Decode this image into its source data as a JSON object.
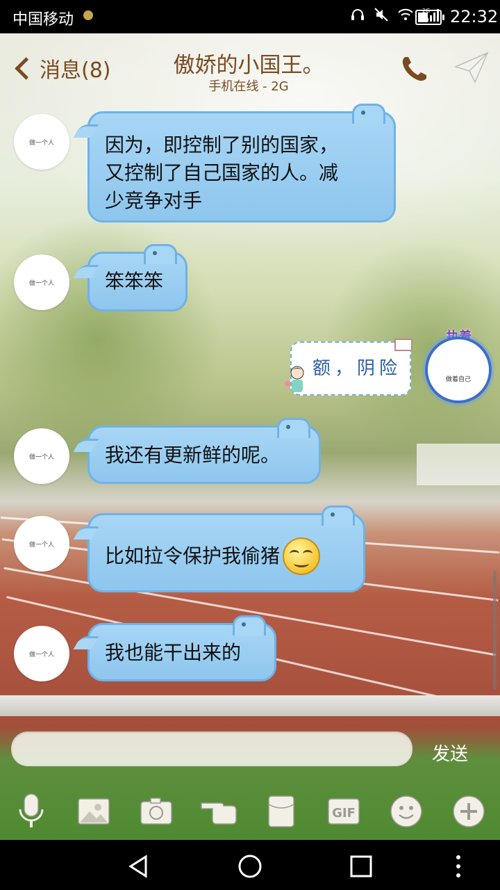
{
  "status_bar": {
    "carrier": "中国移动",
    "network": "2G",
    "time": "22:32",
    "battery_level": 0.45
  },
  "header": {
    "back_label": "消息(8)",
    "title": "傲娇的小国王。",
    "subtitle": "手机在线 - 2G"
  },
  "contact": {
    "avatar_text": "做一个人"
  },
  "me": {
    "avatar_text": "做着自己",
    "badge_text": "执着"
  },
  "messages": [
    {
      "from": "contact",
      "lines": [
        "因为，即控制了别的国家，",
        "又控制了自己国家的人。减",
        "少竞争对手"
      ]
    },
    {
      "from": "contact",
      "lines": [
        "笨笨笨"
      ]
    },
    {
      "from": "me",
      "lines": [
        "额，阴险"
      ]
    },
    {
      "from": "contact",
      "lines": [
        "我还有更新鲜的呢。"
      ]
    },
    {
      "from": "contact",
      "lines": [
        "比如拉令保护我偷猪"
      ],
      "emoji": "smirk-face"
    },
    {
      "from": "contact",
      "lines": [
        "我也能干出来的"
      ]
    }
  ],
  "input": {
    "value": "",
    "send_label": "发送"
  },
  "toolbar": {
    "items": [
      "microphone-icon",
      "picture-icon",
      "camera-icon",
      "poke-hand-icon",
      "red-envelope-icon",
      "gif-icon",
      "emoji-icon",
      "plus-icon"
    ],
    "gif_label": "GIF"
  },
  "colors": {
    "accent_brown": "#7a4a22",
    "bubble_blue": "#a8d6f5",
    "bubble_border": "#6fb2e6"
  }
}
